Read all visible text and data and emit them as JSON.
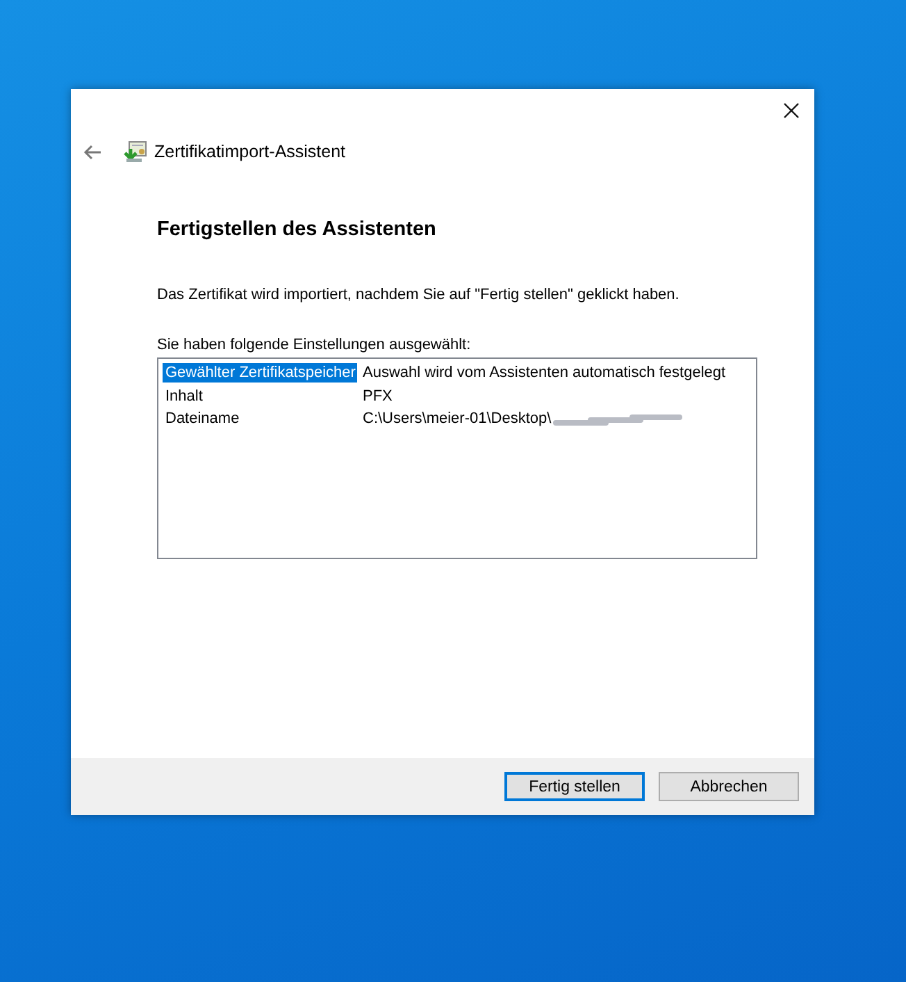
{
  "wizard": {
    "title": "Zertifikatimport-Assistent",
    "heading": "Fertigstellen des Assistenten",
    "intro": "Das Zertifikat wird importiert, nachdem Sie auf \"Fertig stellen\" geklickt haben.",
    "list_label": "Sie haben folgende Einstellungen ausgewählt:",
    "rows": [
      {
        "setting": "Gewählter Zertifikatspeicher",
        "value": "Auswahl wird vom Assistenten automatisch festgelegt",
        "selected": true,
        "redacted": false
      },
      {
        "setting": "Inhalt",
        "value": "PFX",
        "selected": false,
        "redacted": false
      },
      {
        "setting": "Dateiname",
        "value": "C:\\Users\\meier-01\\Desktop\\",
        "selected": false,
        "redacted": true
      }
    ],
    "buttons": [
      {
        "label": "Fertig stellen",
        "default": true
      },
      {
        "label": "Abbrechen",
        "default": false
      }
    ]
  }
}
